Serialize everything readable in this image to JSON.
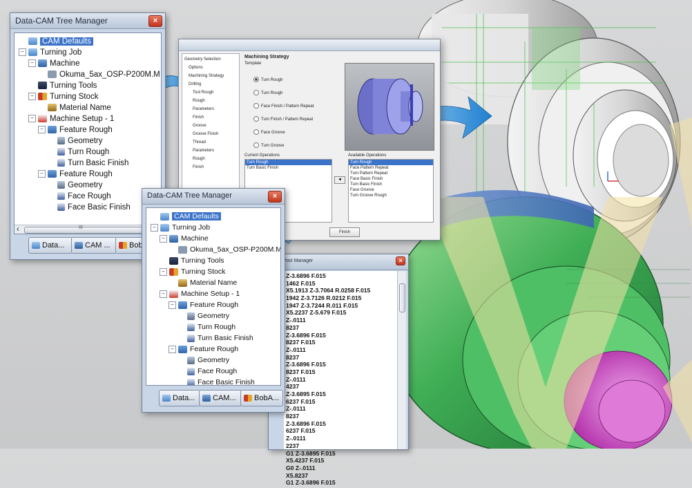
{
  "tree_manager_1": {
    "title": "Data-CAM Tree Manager",
    "close": "×",
    "items": [
      "CAM Defaults",
      "Turning Job",
      "Machine",
      "Okuma_5ax_OSP-P200M.M",
      "Turning Tools",
      "Turning Stock",
      "Material Name",
      "Machine Setup - 1",
      "Feature Rough",
      "Geometry",
      "Turn Rough",
      "Turn Basic Finish",
      "Feature Rough",
      "Geometry",
      "Face Rough",
      "Face Basic Finish"
    ],
    "tabs": [
      "Data...",
      "CAM ...",
      "BobA..."
    ],
    "scroll_left": "‹",
    "scroll_right": "›",
    "scroll_grip": "III"
  },
  "tree_manager_2": {
    "title": "Data-CAM Tree Manager",
    "close": "×",
    "items": [
      "CAM Defaults",
      "Turning Job",
      "Machine",
      "Okuma_5ax_OSP-P200M.M",
      "Turning Tools",
      "Turning Stock",
      "Material Name",
      "Machine Setup - 1",
      "Feature Rough",
      "Geometry",
      "Turn Rough",
      "Turn Basic Finish",
      "Feature Rough",
      "Geometry",
      "Face Rough",
      "Face Basic Finish"
    ],
    "tabs": [
      "Data...",
      "CAM...",
      "BobA..."
    ]
  },
  "wizard": {
    "heading": "Machining Strategy",
    "subheading": "Template",
    "options": [
      "Turn Rough",
      "Turn Rough",
      "Face Finish / Pattern Repeat",
      "Turn Finish / Pattern Repeat",
      "Face Groove",
      "Turn Groove"
    ],
    "left_tree": [
      "Geometry Selection",
      "Options",
      "Machining Strategy",
      "Drilling",
      "Tool Rough",
      "Rough",
      "Parameters",
      "Finish",
      "Groove",
      "Groove Finish",
      "Thread",
      "Parameters",
      "Rough",
      "Finish"
    ],
    "current_label": "Current Operations",
    "available_label": "Available Operations",
    "current_ops": [
      "Turn Rough",
      "Turn Basic Finish"
    ],
    "available_ops": [
      "Turn Rough",
      "Face Pattern Repeat",
      "Turn Pattern Repeat",
      "Face Basic Finish",
      "Turn Basic Finish",
      "Face Groove",
      "Turn Groove Rough"
    ],
    "add_btn": "◄",
    "finish_btn": "Finish"
  },
  "post_manager": {
    "title": "ICS Post Manager",
    "close": "×",
    "lines": [
      "Z-3.6896 F.015",
      "1462 F.015",
      "X5.1913 Z-3.7064 R.0258 F.015",
      "1942 Z-3.7126 R.0212 F.015",
      "1947 Z-3.7244 R.011 F.015",
      "X5.2237 Z-5.679 F.015",
      "Z-.0111",
      "8237",
      "Z-3.6896 F.015",
      "8237 F.015",
      "Z-.0111",
      "8237",
      "Z-3.6896 F.015",
      "8237 F.015",
      "Z-.0111",
      "4237",
      "Z-3.6895 F.015",
      "6237 F.015",
      "Z-.0111",
      "8237",
      "Z-3.6896 F.015",
      "6237 F.015",
      "Z-.0111",
      "2237",
      "G1 Z-3.6895 F.015",
      "X5.4237 F.015",
      "G0 Z-.0111",
      "X5.8237",
      "G1 Z-3.6896 F.015"
    ]
  },
  "colors": {
    "window_frame": "#c9d6e8",
    "selection": "#3b73c9",
    "arrow": "#2e8fd8",
    "part_green": "#3fae55",
    "part_magenta": "#d04fc8",
    "watermark": "#f4e2a6"
  },
  "icons": [
    "folder-icon",
    "machine-icon",
    "tools-icon",
    "stock-icon",
    "material-icon",
    "setup-icon",
    "feature-icon",
    "geometry-icon",
    "operation-icon",
    "close-icon",
    "blue-arrow-icon"
  ]
}
